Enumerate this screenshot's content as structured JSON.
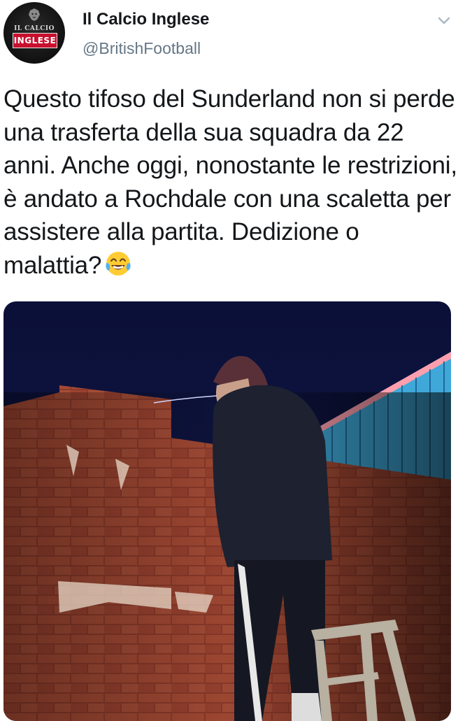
{
  "tweet": {
    "display_name": "Il Calcio Inglese",
    "handle": "@BritishFootball",
    "text": "Questo tifoso del Sunderland non si perde una trasferta della sua squadra da 22 anni. Anche oggi, nonostante le restrizioni, è andato a Rochdale con una scaletta per assistere alla partita. Dedizione o malattia?",
    "emoji": "face-with-tears-of-joy",
    "avatar": {
      "line1": "IL CALCIO",
      "line2": "INGLESE",
      "accent": "#c8102e"
    }
  },
  "colors": {
    "text": "#14171a",
    "secondary": "#657786"
  }
}
